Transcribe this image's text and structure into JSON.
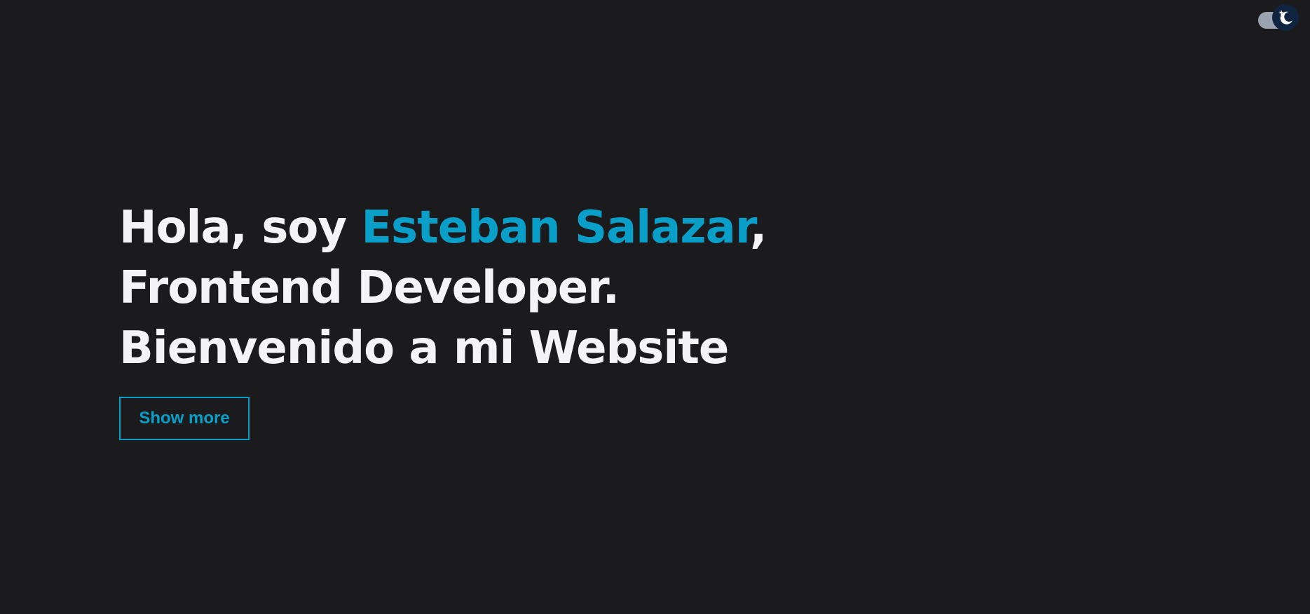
{
  "theme_toggle": {
    "icon": "moon-stars-icon",
    "mode": "dark",
    "colors": {
      "track": "#9aa3af",
      "knob": "#0f2440",
      "icon": "#ffffff"
    }
  },
  "hero": {
    "line1_prefix": "Hola, soy ",
    "name": "Esteban Salazar",
    "line1_suffix": ",",
    "line2": "Frontend Developer.",
    "line3": "Bienvenido a mi Website"
  },
  "cta": {
    "label": "Show more"
  },
  "colors": {
    "background": "#1b1b1e",
    "text": "#f4f4f6",
    "accent": "#0a9fc8"
  }
}
